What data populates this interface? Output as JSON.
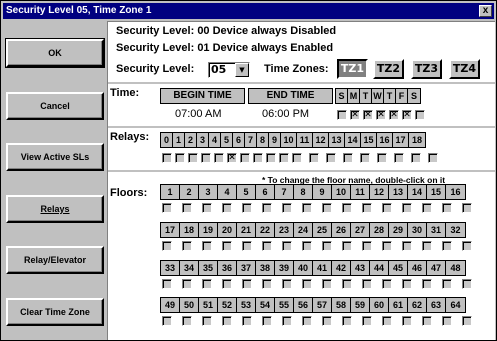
{
  "window": {
    "title": "Security Level 05, Time Zone 1",
    "close_label": "x"
  },
  "buttons": {
    "ok": "OK",
    "cancel": "Cancel",
    "view_active": "View Active SLs",
    "relays": "Relays",
    "relay_elevator": "Relay/Elevator",
    "clear_time_zone": "Clear Time Zone"
  },
  "header": {
    "line1": "Security Level:  00 Device always Disabled",
    "line2": "Security Level:  01 Device always Enabled",
    "sl_label": "Security Level:",
    "sl_value": "05",
    "tz_label": "Time Zones:",
    "time_zones": [
      "TZ1",
      "TZ2",
      "TZ3",
      "TZ4"
    ],
    "active_tz": "TZ1"
  },
  "time": {
    "label": "Time:",
    "begin_header": "BEGIN TIME",
    "end_header": "END TIME",
    "begin_value": "07:00 AM",
    "end_value": "06:00 PM",
    "days": [
      "S",
      "M",
      "T",
      "W",
      "T",
      "F",
      "S"
    ],
    "day_checked": [
      false,
      true,
      true,
      true,
      true,
      true,
      false
    ]
  },
  "relays": {
    "label": "Relays:",
    "numbers": [
      "0",
      "1",
      "2",
      "3",
      "4",
      "5",
      "6",
      "7",
      "8",
      "9",
      "10",
      "11",
      "12",
      "13",
      "14",
      "15",
      "16",
      "17",
      "18"
    ],
    "checked": [
      5
    ]
  },
  "floors": {
    "label": "Floors:",
    "hint": "* To change the floor name, double-click on it",
    "rows": [
      [
        "1",
        "2",
        "3",
        "4",
        "5",
        "6",
        "7",
        "8",
        "9",
        "10",
        "11",
        "12",
        "13",
        "14",
        "15",
        "16"
      ],
      [
        "17",
        "18",
        "19",
        "20",
        "21",
        "22",
        "23",
        "24",
        "25",
        "26",
        "27",
        "28",
        "29",
        "30",
        "31",
        "32"
      ],
      [
        "33",
        "34",
        "35",
        "36",
        "37",
        "38",
        "39",
        "40",
        "41",
        "42",
        "43",
        "44",
        "45",
        "46",
        "47",
        "48"
      ],
      [
        "49",
        "50",
        "51",
        "52",
        "53",
        "54",
        "55",
        "56",
        "57",
        "58",
        "59",
        "60",
        "61",
        "62",
        "63",
        "64"
      ]
    ]
  }
}
